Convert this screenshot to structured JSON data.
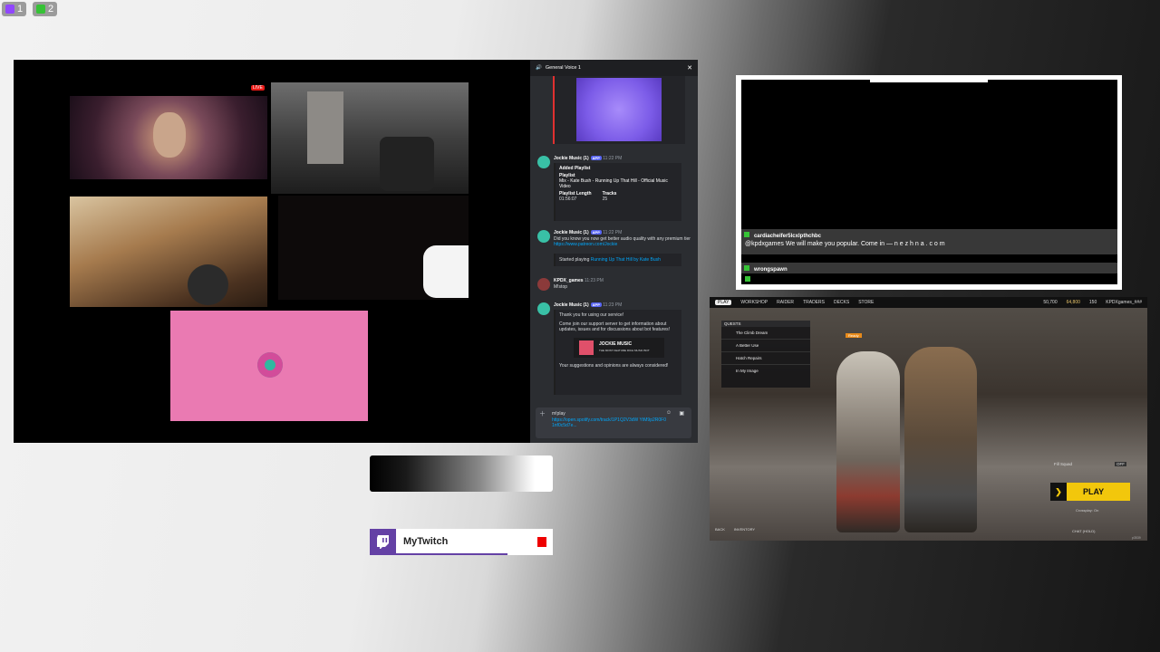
{
  "counters": [
    {
      "value": "1",
      "color": "#9146ff"
    },
    {
      "value": "2",
      "color": "#36c236"
    }
  ],
  "video": {
    "live_badge": "LIVE"
  },
  "discord": {
    "channel": "General Voice 1",
    "messages": [
      {
        "author": "Jockie Music (1)",
        "badge": "APP",
        "time": "11:22 PM",
        "embed_title": "Added Playlist",
        "playlist_label": "Playlist",
        "playlist_name": "Mix - Kate Bush - Running Up That Hill - Official Music Video",
        "length_label": "Playlist Length",
        "length_value": "01:56:07",
        "tracks_label": "Tracks",
        "tracks_value": "25"
      },
      {
        "author": "Jockie Music (1)",
        "badge": "APP",
        "time": "11:22 PM",
        "text": "Did you know you now get better audio quality with any premium tier",
        "link": "https://www.patreon.com/Jockie",
        "now_playing_prefix": "Started playing",
        "now_playing_track": "Running Up That Hill by Kate Bush"
      },
      {
        "author": "KPDX_games",
        "time": "11:23 PM",
        "text": "M!stop"
      },
      {
        "author": "Jockie Music (1)",
        "badge": "APP",
        "time": "11:23 PM",
        "text": "Thank you for using our service!",
        "text2": "Come join our support server to get information about updates, issues and for discussions about bot features!",
        "banner": "JOCKIE MUSIC",
        "banner_sub": "THE MOST FEATURE RICH MUSIC BOT",
        "footer": "Your suggestions and opinions are always considered!"
      }
    ],
    "input": {
      "command": "m!play",
      "url": "https://open.spotify.com/track/1P1Q2V3dW YtM9p2R0F0 1nf0c5d7e..."
    }
  },
  "stream_chat": [
    {
      "user": "cardiacheifer5lcxlpthchbc",
      "text": ""
    },
    {
      "user": "",
      "text": "@kpdxgames We will make you popular. Come in — n e z h n a . c o m"
    },
    {
      "user": "wrongspawn",
      "text": ""
    }
  ],
  "game": {
    "nav": [
      "PLAY",
      "WORKSHOP",
      "RAIDER",
      "TRADERS",
      "DECKS",
      "STORE"
    ],
    "currency": [
      "50,700",
      "64,800",
      "150"
    ],
    "player": "KPDXgames_###",
    "quests_title": "QUESTS",
    "quests": [
      "The Climb Dream",
      "A Better Use",
      "Hatch Repairs",
      "In My Image"
    ],
    "ready": "Ready",
    "fill_squad": "Fill Squad",
    "fill_state": "OFF",
    "play_button": "PLAY",
    "crossplay": "Crossplay: On",
    "footer_back": "BACK",
    "footer_inventory": "INVENTORY",
    "footer_right": "CHAT (HOLD)",
    "version": "p3539"
  },
  "twitch_card": {
    "label": "MyTwitch",
    "accent": "#6441a5"
  }
}
